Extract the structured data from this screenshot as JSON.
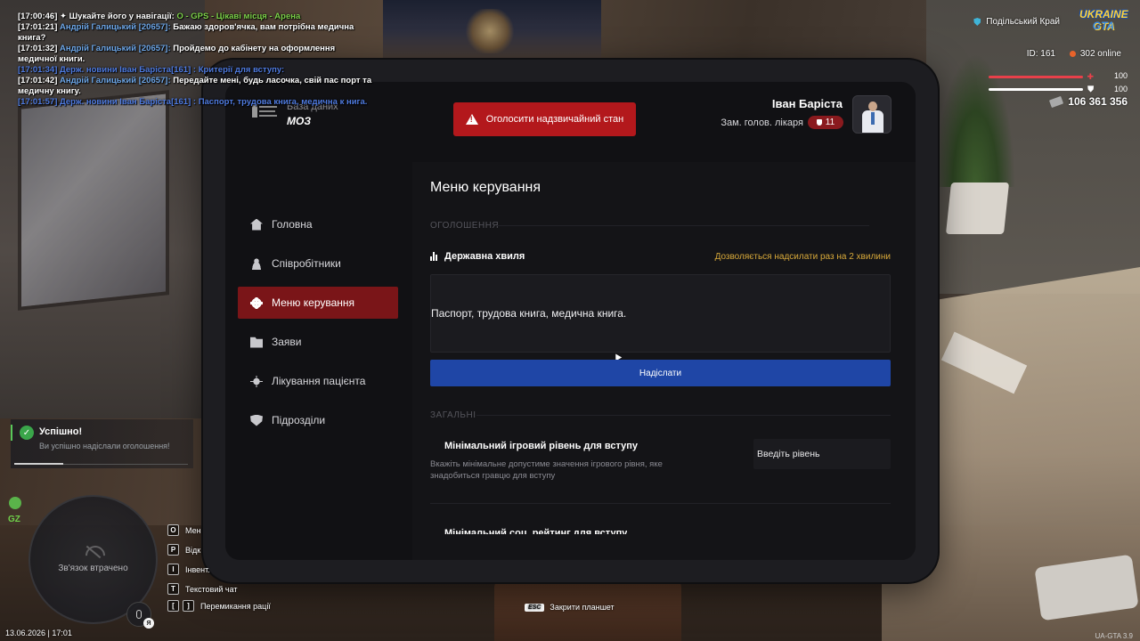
{
  "chat": [
    {
      "time": "[17:00:46]",
      "prefix": " ✦ ",
      "text": "Шукайте його у навігації: ",
      "highlight": "O - GPS - Цікаві місця - Арена"
    },
    {
      "time": "[17:01:21]",
      "name": " Андрій Галицький [20657]:",
      "text": " Бажаю здоров'ячка, вам потрібна медична книга?"
    },
    {
      "time": "[17:01:32]",
      "name": " Андрій Галицький [20657]:",
      "text": " Пройдемо до кабінету на оформлення медичної книги."
    },
    {
      "gov": "[17:01:34] Держ. новини Іван Баріста[161] : Критерії для вступу:"
    },
    {
      "time": "[17:01:42]",
      "name": " Андрій Галицький [20657]:",
      "text": " Передайте мені, будь ласочка, свій пас порт та медичну книгу."
    },
    {
      "gov": "[17:01:57] Держ. новини Іван Баріста[161] : Паспорт, трудова книга, медична к нига."
    }
  ],
  "hud": {
    "region": "Подільський Край",
    "logo_line1": "UKRAINE",
    "logo_line2": "GTA",
    "player_id": "ID: 161",
    "online": "302 online",
    "health": "100",
    "armor": "100",
    "money": "106 361 356",
    "gz": "GZ",
    "minimap_text": "Зв'язок втрачено",
    "mic_key": "Я",
    "datetime": "13.06.2026 | 17:01",
    "esc_key": "ESC",
    "esc_label": "Закрити планшет",
    "version": "UA-GTA 3.9"
  },
  "keybinds": [
    {
      "keys": [
        "O"
      ],
      "label": "Мен"
    },
    {
      "keys": [
        "P"
      ],
      "label": "Відк"
    },
    {
      "keys": [
        "I"
      ],
      "label": "Інвент."
    },
    {
      "keys": [
        "T"
      ],
      "label": "Текстовий чат"
    },
    {
      "keys": [
        "[",
        "]"
      ],
      "label": "Перемикання рації"
    }
  ],
  "toast": {
    "title": "Успішно!",
    "text": "Ви успішно надіслали оголошення!",
    "progress": 0.28
  },
  "tablet": {
    "db_label": "База даних",
    "org": "МОЗ",
    "emergency_label": "Оголосити надзвичайний стан",
    "user_name": "Іван Баріста",
    "user_rank": "Зам. голов. лікаря",
    "rank_level": "11",
    "nav": [
      {
        "label": "Головна",
        "icon": "home-icon",
        "active": false
      },
      {
        "label": "Співробітники",
        "icon": "people-icon",
        "active": false
      },
      {
        "label": "Меню керування",
        "icon": "gear-icon",
        "active": true
      },
      {
        "label": "Заяви",
        "icon": "folder-icon",
        "active": false
      },
      {
        "label": "Лікування пацієнта",
        "icon": "virus-icon",
        "active": false
      },
      {
        "label": "Підрозділи",
        "icon": "shield-icon",
        "active": false
      }
    ],
    "main": {
      "title": "Меню керування",
      "section_announce": "ОГОЛОШЕННЯ",
      "wave_title": "Державна хвиля",
      "wave_note": "Дозволяється надсилати раз на 2 хвилини",
      "message": "Паспорт, трудова книга, медична книга.",
      "send_label": "Надіслати",
      "section_general": "ЗАГАЛЬНІ",
      "min_level_title": "Мінімальний ігровий рівень для вступу",
      "min_level_desc": "Вкажіть мінімальне допустиме значення ігрового рівня, яке знадобиться гравцю для вступу",
      "min_level_placeholder": "Введіть рівень",
      "min_rating_title": "Мінімальний соц. рейтинг для вступу"
    }
  },
  "colors": {
    "accent_red": "#b3181c",
    "active_nav": "#7a1518",
    "send_blue": "#1f46a6",
    "note_yellow": "#d8a93a",
    "success_green": "#3aa64a"
  }
}
